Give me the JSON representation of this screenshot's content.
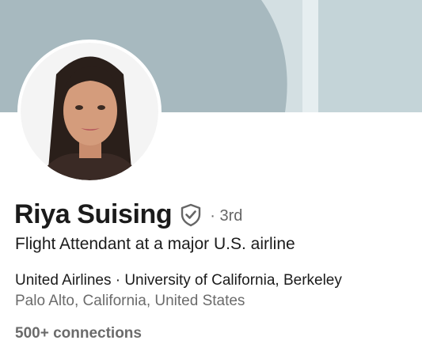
{
  "profile": {
    "name": "Riya Suising",
    "verified_icon": "shield-check-icon",
    "degree": "· 3rd",
    "headline": "Flight Attendant at a major U.S. airline",
    "affiliations": "United Airlines · University of California, Berkeley",
    "location": "Palo Alto, California, United States",
    "connections": "500+ connections"
  },
  "colors": {
    "banner_light": "#d3dfe2",
    "banner_dark": "#a7b9bf",
    "text_primary": "#1b1b1b",
    "text_secondary": "#6b6b6b"
  }
}
